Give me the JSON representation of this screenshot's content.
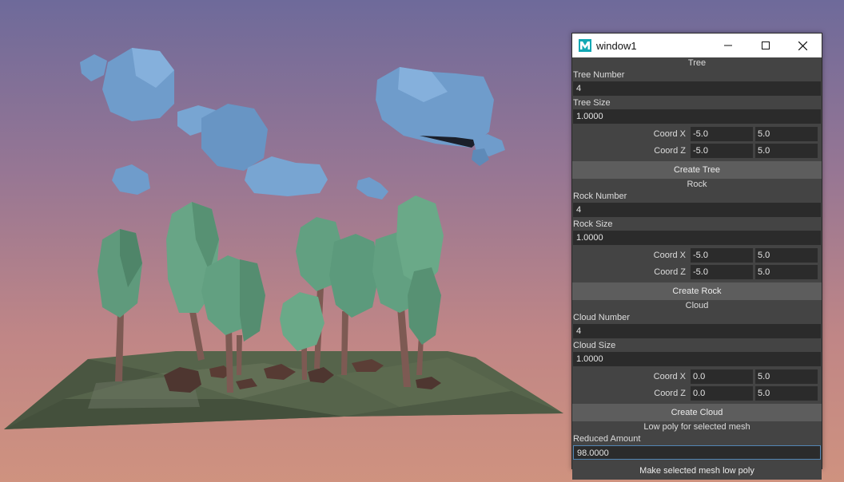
{
  "window": {
    "title": "window1",
    "icon": "maya-m-icon"
  },
  "tree": {
    "section_title": "Tree",
    "number_label": "Tree Number",
    "number_value": "4",
    "size_label": "Tree Size",
    "size_value": "1.0000",
    "coord_x_label": "Coord X",
    "coord_x_min": "-5.0",
    "coord_x_max": "5.0",
    "coord_z_label": "Coord Z",
    "coord_z_min": "-5.0",
    "coord_z_max": "5.0",
    "button": "Create Tree"
  },
  "rock": {
    "section_title": "Rock",
    "number_label": "Rock Number",
    "number_value": "4",
    "size_label": "Rock Size",
    "size_value": "1.0000",
    "coord_x_label": "Coord X",
    "coord_x_min": "-5.0",
    "coord_x_max": "5.0",
    "coord_z_label": "Coord Z",
    "coord_z_min": "-5.0",
    "coord_z_max": "5.0",
    "button": "Create Rock"
  },
  "cloud": {
    "section_title": "Cloud",
    "number_label": "Cloud Number",
    "number_value": "4",
    "size_label": "Cloud Size",
    "size_value": "1.0000",
    "coord_x_label": "Coord X",
    "coord_x_min": "0.0",
    "coord_x_max": "5.0",
    "coord_z_label": "Coord Z",
    "coord_z_min": "0.0",
    "coord_z_max": "5.0",
    "button": "Create Cloud"
  },
  "lowpoly": {
    "section_title": "Low poly for selected mesh",
    "reduce_label": "Reduced Amount",
    "reduce_value": "98.0000",
    "button": "Make selected mesh low poly"
  },
  "colors": {
    "panel_bg": "#444444",
    "field_bg": "#2b2b2b",
    "button_bg": "#5d5d5d",
    "title_bar": "#ffffff",
    "focus_border": "#5285b3",
    "sky_top": "#6e6a9a",
    "sky_bottom": "#cf927f",
    "tree_green": "#5f9a7c",
    "cloud_blue": "#6f9ccb",
    "ground": "#5a6a4e"
  }
}
